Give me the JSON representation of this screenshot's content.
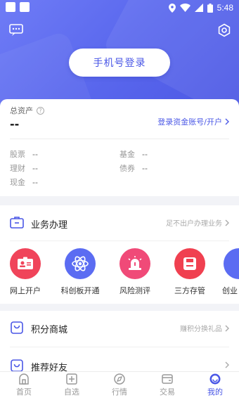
{
  "status_bar": {
    "time": "5:48"
  },
  "header": {
    "login_button": "手机号登录"
  },
  "assets": {
    "label": "总资产",
    "value": "--",
    "link": "登录资金账号/开户",
    "stats": [
      {
        "name": "股票",
        "value": "--"
      },
      {
        "name": "基金",
        "value": "--"
      },
      {
        "name": "理财",
        "value": "--"
      },
      {
        "name": "债券",
        "value": "--"
      },
      {
        "name": "现金",
        "value": "--"
      }
    ]
  },
  "business": {
    "title": "业务办理",
    "right": "足不出户办理业务",
    "items": [
      {
        "label": "网上开户",
        "color": "#f0445a"
      },
      {
        "label": "科创板开通",
        "color": "#5b6cf2"
      },
      {
        "label": "风险测评",
        "color": "#f04a78"
      },
      {
        "label": "三方存管",
        "color": "#f04050"
      },
      {
        "label": "创业",
        "color": "#5b6cf2"
      }
    ]
  },
  "points_mall": {
    "title": "积分商城",
    "right": "赚积分换礼品"
  },
  "recommend": {
    "title": "推荐好友"
  },
  "tabs": [
    {
      "label": "首页",
      "icon": "home-icon"
    },
    {
      "label": "自选",
      "icon": "plus-square-icon"
    },
    {
      "label": "行情",
      "icon": "compass-icon"
    },
    {
      "label": "交易",
      "icon": "wallet-icon"
    },
    {
      "label": "我的",
      "icon": "smile-icon",
      "active": true
    }
  ],
  "colors": {
    "accent": "#4a57e6",
    "header": "#5b69ee"
  }
}
